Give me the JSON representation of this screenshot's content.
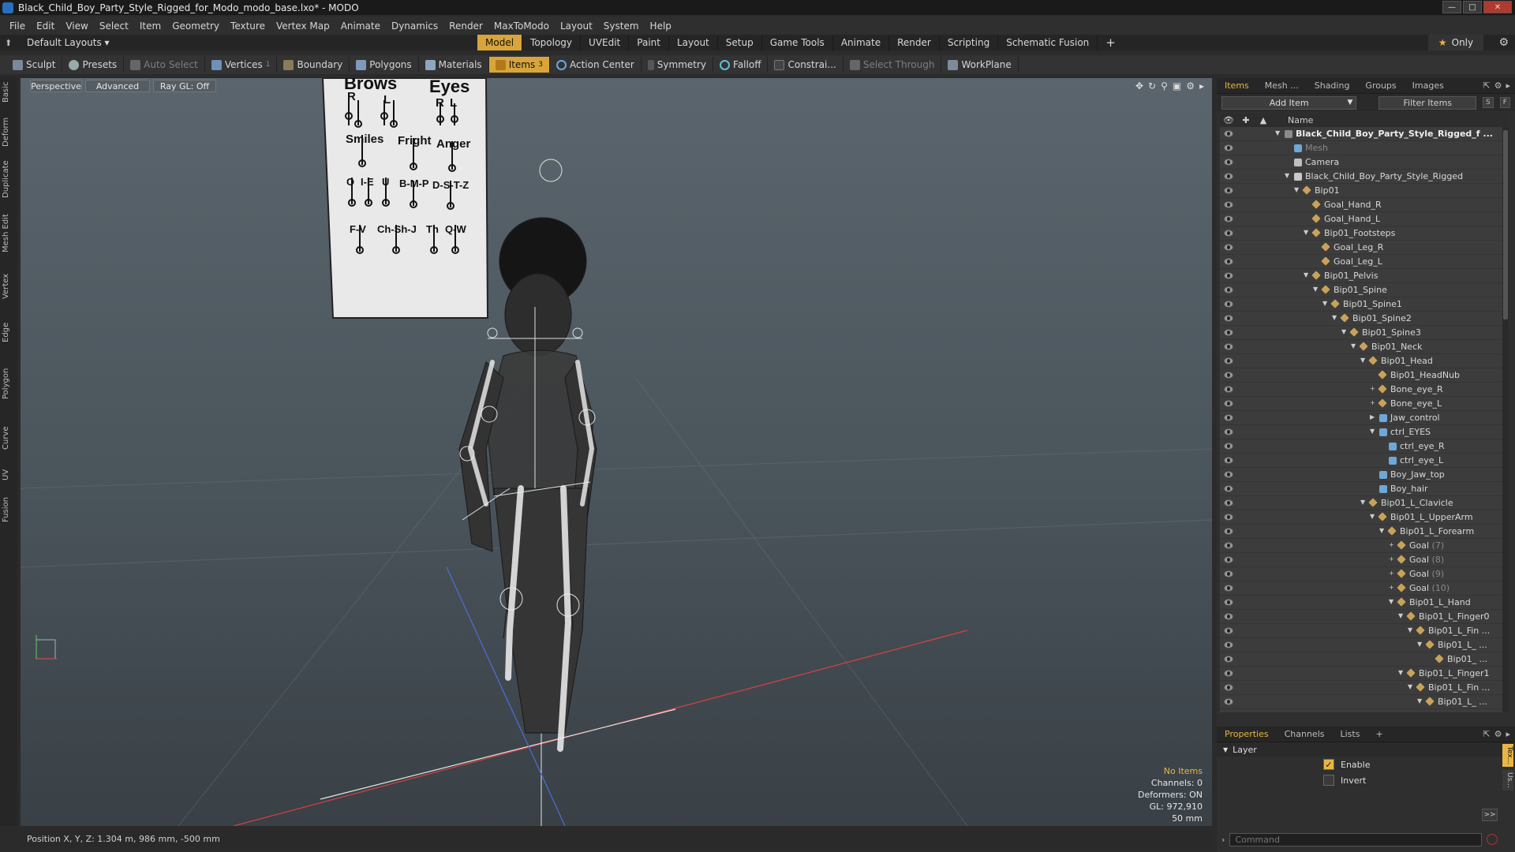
{
  "window": {
    "title": "Black_Child_Boy_Party_Style_Rigged_for_Modo_modo_base.lxo* - MODO",
    "controls": [
      "—",
      "□",
      "✕"
    ]
  },
  "menubar": [
    "File",
    "Edit",
    "View",
    "Select",
    "Item",
    "Geometry",
    "Texture",
    "Vertex Map",
    "Animate",
    "Dynamics",
    "Render",
    "MaxToModo",
    "Layout",
    "System",
    "Help"
  ],
  "layoutbar": {
    "layouts_label": "Default Layouts ▾",
    "tabs": [
      "Model",
      "Topology",
      "UVEdit",
      "Paint",
      "Layout",
      "Setup",
      "Game Tools",
      "Animate",
      "Render",
      "Scripting",
      "Schematic Fusion"
    ],
    "active_tab": "Model",
    "add": "+",
    "only_label": "Only"
  },
  "toolbar": {
    "sculpt": "Sculpt",
    "presets": "Presets",
    "auto_select": "Auto Select",
    "vertices": "Vertices",
    "vertices_count": "1",
    "boundary": "Boundary",
    "polygons": "Polygons",
    "materials": "Materials",
    "items": "Items",
    "items_count": "3",
    "action_center": "Action Center",
    "symmetry": "Symmetry",
    "falloff": "Falloff",
    "constraints": "Constrai...",
    "select_through": "Select Through",
    "workplane": "WorkPlane"
  },
  "left_tabs": [
    "Basic",
    "Deform",
    "Duplicate",
    "Mesh Edit",
    "Vertex",
    "Edge",
    "Polygon",
    "Curve",
    "UV",
    "Fusion"
  ],
  "viewport": {
    "view_mode": "Perspective",
    "shading": "Advanced",
    "raygl": "Ray GL: Off",
    "board": {
      "brows": "Brows",
      "eyes": "Eyes",
      "r": "R",
      "l": "L",
      "smiles": "Smiles",
      "fright": "Fright",
      "anger": "Anger",
      "o": "O",
      "i_e": "I-E",
      "u": "U",
      "b_m_p": "B-M-P",
      "d_s_t_z": "D-S-T-Z",
      "f_v": "F-V",
      "ch_sh_j": "Ch-Sh-J",
      "th": "Th",
      "q_w": "Q-W"
    },
    "info": {
      "no_items": "No Items",
      "channels": "Channels: 0",
      "deformers": "Deformers: ON",
      "gl": "GL: 972,910",
      "focal": "50 mm"
    }
  },
  "statusbar": "Position X, Y, Z:  1.304 m, 986 mm, -500 mm",
  "items_panel": {
    "tabs": [
      "Items",
      "Mesh ...",
      "Shading",
      "Groups",
      "Images"
    ],
    "active_tab": "Items",
    "add_item": "Add Item",
    "filter": "Filter Items",
    "s_btn": "S",
    "f_btn": "F",
    "column_name": "Name",
    "tree": [
      {
        "label": "Black_Child_Boy_Party_Style_Rigged_f ...",
        "depth": 0,
        "arrow": "▼",
        "icon": "scene",
        "bold": true
      },
      {
        "label": "Mesh",
        "depth": 1,
        "arrow": "",
        "icon": "mesh",
        "gray": true
      },
      {
        "label": "Camera",
        "depth": 1,
        "arrow": "",
        "icon": "camera"
      },
      {
        "label": "Black_Child_Boy_Party_Style_Rigged",
        "depth": 1,
        "arrow": "▼",
        "icon": "group"
      },
      {
        "label": "Bip01",
        "depth": 2,
        "arrow": "▼",
        "icon": "bone"
      },
      {
        "label": "Goal_Hand_R",
        "depth": 3,
        "arrow": "",
        "icon": "bone"
      },
      {
        "label": "Goal_Hand_L",
        "depth": 3,
        "arrow": "",
        "icon": "bone"
      },
      {
        "label": "Bip01_Footsteps",
        "depth": 3,
        "arrow": "▼",
        "icon": "bone"
      },
      {
        "label": "Goal_Leg_R",
        "depth": 4,
        "arrow": "",
        "icon": "bone"
      },
      {
        "label": "Goal_Leg_L",
        "depth": 4,
        "arrow": "",
        "icon": "bone"
      },
      {
        "label": "Bip01_Pelvis",
        "depth": 3,
        "arrow": "▼",
        "icon": "bone"
      },
      {
        "label": "Bip01_Spine",
        "depth": 4,
        "arrow": "▼",
        "icon": "bone"
      },
      {
        "label": "Bip01_Spine1",
        "depth": 5,
        "arrow": "▼",
        "icon": "bone"
      },
      {
        "label": "Bip01_Spine2",
        "depth": 6,
        "arrow": "▼",
        "icon": "bone"
      },
      {
        "label": "Bip01_Spine3",
        "depth": 7,
        "arrow": "▼",
        "icon": "bone"
      },
      {
        "label": "Bip01_Neck",
        "depth": 8,
        "arrow": "▼",
        "icon": "bone"
      },
      {
        "label": "Bip01_Head",
        "depth": 9,
        "arrow": "▼",
        "icon": "bone"
      },
      {
        "label": "Bip01_HeadNub",
        "depth": 10,
        "arrow": "",
        "icon": "bone"
      },
      {
        "label": "Bone_eye_R",
        "depth": 10,
        "arrow": "+",
        "icon": "bone"
      },
      {
        "label": "Bone_eye_L",
        "depth": 10,
        "arrow": "+",
        "icon": "bone"
      },
      {
        "label": "Jaw_control",
        "depth": 10,
        "arrow": "▶",
        "icon": "mesh"
      },
      {
        "label": "ctrl_EYES",
        "depth": 10,
        "arrow": "▼",
        "icon": "mesh"
      },
      {
        "label": "ctrl_eye_R",
        "depth": 11,
        "arrow": "",
        "icon": "mesh"
      },
      {
        "label": "ctrl_eye_L",
        "depth": 11,
        "arrow": "",
        "icon": "mesh"
      },
      {
        "label": "Boy_Jaw_top",
        "depth": 10,
        "arrow": "",
        "icon": "mesh"
      },
      {
        "label": "Boy_hair",
        "depth": 10,
        "arrow": "",
        "icon": "mesh"
      },
      {
        "label": "Bip01_L_Clavicle",
        "depth": 9,
        "arrow": "▼",
        "icon": "bone"
      },
      {
        "label": "Bip01_L_UpperArm",
        "depth": 10,
        "arrow": "▼",
        "icon": "bone"
      },
      {
        "label": "Bip01_L_Forearm",
        "depth": 11,
        "arrow": "▼",
        "icon": "bone"
      },
      {
        "label": "Goal",
        "suffix": " (7)",
        "depth": 12,
        "arrow": "+",
        "icon": "bone"
      },
      {
        "label": "Goal",
        "suffix": " (8)",
        "depth": 12,
        "arrow": "+",
        "icon": "bone"
      },
      {
        "label": "Goal",
        "suffix": " (9)",
        "depth": 12,
        "arrow": "+",
        "icon": "bone"
      },
      {
        "label": "Goal",
        "suffix": " (10)",
        "depth": 12,
        "arrow": "+",
        "icon": "bone"
      },
      {
        "label": "Bip01_L_Hand",
        "depth": 12,
        "arrow": "▼",
        "icon": "bone"
      },
      {
        "label": "Bip01_L_Finger0",
        "depth": 13,
        "arrow": "▼",
        "icon": "bone"
      },
      {
        "label": "Bip01_L_Fin ...",
        "depth": 14,
        "arrow": "▼",
        "icon": "bone"
      },
      {
        "label": "Bip01_L_ ...",
        "depth": 15,
        "arrow": "▼",
        "icon": "bone"
      },
      {
        "label": "Bip01_ ...",
        "depth": 16,
        "arrow": "",
        "icon": "bone"
      },
      {
        "label": "Bip01_L_Finger1",
        "depth": 13,
        "arrow": "▼",
        "icon": "bone"
      },
      {
        "label": "Bip01_L_Fin ...",
        "depth": 14,
        "arrow": "▼",
        "icon": "bone"
      },
      {
        "label": "Bip01_L_ ...",
        "depth": 15,
        "arrow": "▼",
        "icon": "bone"
      }
    ]
  },
  "properties_panel": {
    "tabs": [
      "Properties",
      "Channels",
      "Lists"
    ],
    "active_tab": "Properties",
    "add": "+",
    "section": "Layer",
    "enable": {
      "label": "Enable",
      "checked": true
    },
    "invert": {
      "label": "Invert",
      "checked": false
    },
    "side_tabs": [
      "Tex...",
      "Us..."
    ],
    "more": ">>",
    "command_placeholder": "Command"
  },
  "colors": {
    "accent": "#d9a53a",
    "highlight_text": "#e8b642",
    "viewport_top": "#5b656d",
    "viewport_bottom": "#394046"
  }
}
